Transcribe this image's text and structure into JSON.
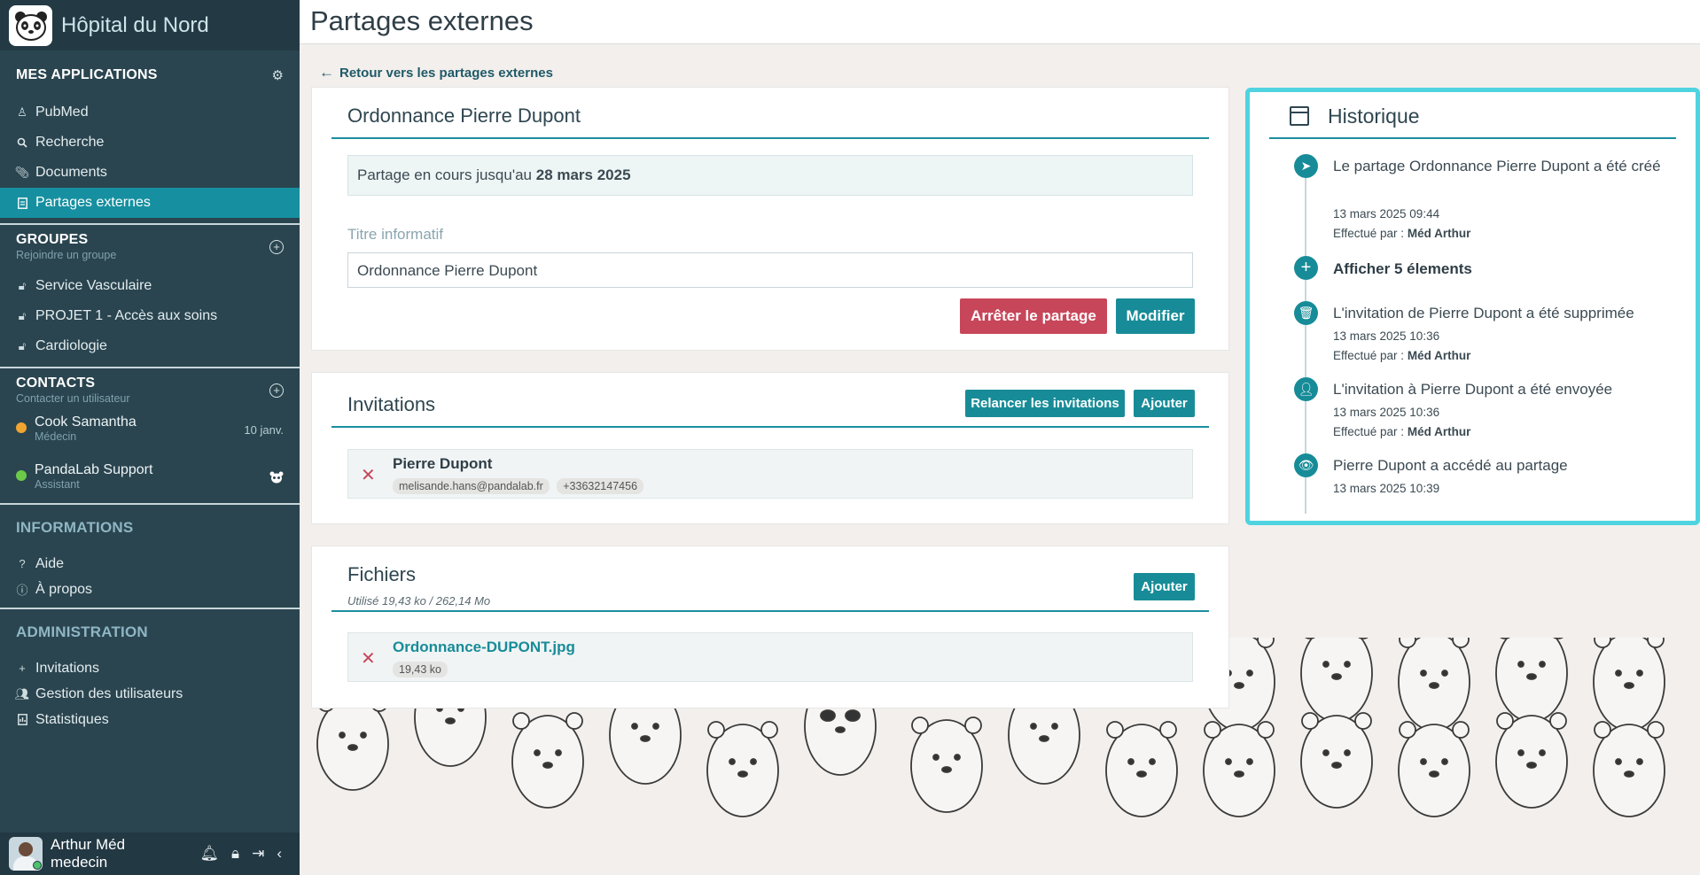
{
  "brand": {
    "name": "Hôpital du Nord",
    "logo_icon": "panda-icon"
  },
  "sidebar": {
    "apps": {
      "title": "MES APPLICATIONS",
      "items": [
        {
          "label": "PubMed",
          "icon": "person-icon"
        },
        {
          "label": "Recherche",
          "icon": "search-icon"
        },
        {
          "label": "Documents",
          "icon": "paperclip-icon"
        },
        {
          "label": "Partages externes",
          "icon": "document-icon",
          "active": true
        }
      ]
    },
    "groups": {
      "title": "GROUPES",
      "subtitle": "Rejoindre un groupe",
      "items": [
        {
          "label": "Service Vasculaire",
          "icon": "lock-icon"
        },
        {
          "label": "PROJET 1 - Accès aux soins",
          "icon": "lock-icon"
        },
        {
          "label": "Cardiologie",
          "icon": "lock-icon"
        }
      ]
    },
    "contacts": {
      "title": "CONTACTS",
      "subtitle": "Contacter un utilisateur",
      "items": [
        {
          "name": "Cook Samantha",
          "role": "Médecin",
          "date": "10 janv.",
          "status_color": "#f0a531"
        },
        {
          "name": "PandaLab Support",
          "role": "Assistant",
          "status_color": "#6cc94a"
        }
      ]
    },
    "info": {
      "title": "INFORMATIONS",
      "items": [
        {
          "label": "Aide",
          "icon": "question-icon"
        },
        {
          "label": "À propos",
          "icon": "info-icon"
        }
      ]
    },
    "admin": {
      "title": "ADMINISTRATION",
      "items": [
        {
          "label": "Invitations",
          "icon": "plus-icon"
        },
        {
          "label": "Gestion des utilisateurs",
          "icon": "users-icon"
        },
        {
          "label": "Statistiques",
          "icon": "stats-icon"
        }
      ]
    },
    "user": {
      "name": "Arthur Méd",
      "role": "medecin"
    }
  },
  "page": {
    "title": "Partages externes",
    "back_link": "Retour vers les partages externes"
  },
  "share": {
    "title": "Ordonnance Pierre Dupont",
    "notice_prefix": "Partage en cours jusqu'au",
    "notice_date": "28 mars 2025",
    "field_label": "Titre informatif",
    "field_value": "Ordonnance Pierre Dupont",
    "stop_label": "Arrêter le partage",
    "edit_label": "Modifier"
  },
  "invitations": {
    "title": "Invitations",
    "resend_label": "Relancer les invitations",
    "add_label": "Ajouter",
    "items": [
      {
        "name": "Pierre Dupont",
        "email": "melisande.hans@pandalab.fr",
        "phone": "+33632147456"
      }
    ]
  },
  "files": {
    "title": "Fichiers",
    "usage": "Utilisé 19,43 ko / 262,14 Mo",
    "add_label": "Ajouter",
    "items": [
      {
        "name": "Ordonnance-DUPONT.jpg",
        "size": "19,43 ko"
      }
    ]
  },
  "history": {
    "title": "Historique",
    "by_label": "Effectué par :",
    "events": [
      {
        "text": "Le partage Ordonnance Pierre Dupont a été créé",
        "date": "13 mars 2025 09:44",
        "by": "Méd Arthur",
        "icon": "send-icon"
      },
      {
        "show_more": "Afficher 5 élements",
        "icon": "plus-circle-icon"
      },
      {
        "text": "L'invitation de Pierre Dupont a été supprimée",
        "date": "13 mars 2025 10:36",
        "by": "Méd Arthur",
        "icon": "trash-icon"
      },
      {
        "text": "L'invitation à Pierre Dupont a été envoyée",
        "date": "13 mars 2025 10:36",
        "by": "Méd Arthur",
        "icon": "user-icon"
      },
      {
        "text": "Pierre Dupont a accédé au partage",
        "date": "13 mars 2025 10:39",
        "icon": "eye-icon"
      }
    ]
  },
  "colors": {
    "accent": "#178c98",
    "danger": "#c8465a",
    "sidebar": "#2a4550",
    "highlight": "#4fd3e0"
  }
}
